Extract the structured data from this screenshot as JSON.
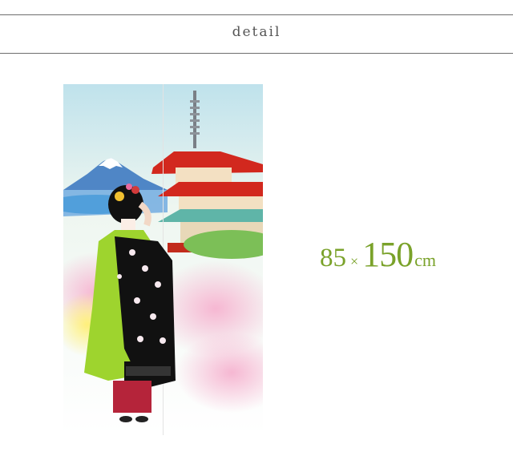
{
  "header": {
    "title": "detail"
  },
  "product": {
    "image_icon": "noren-curtain-maiko-pagoda-fuji",
    "colors": {
      "accent": "#7aa22a",
      "rule": "#6e6e6e"
    }
  },
  "dimensions": {
    "width": "85",
    "times": "×",
    "height": "150",
    "unit": "cm"
  }
}
